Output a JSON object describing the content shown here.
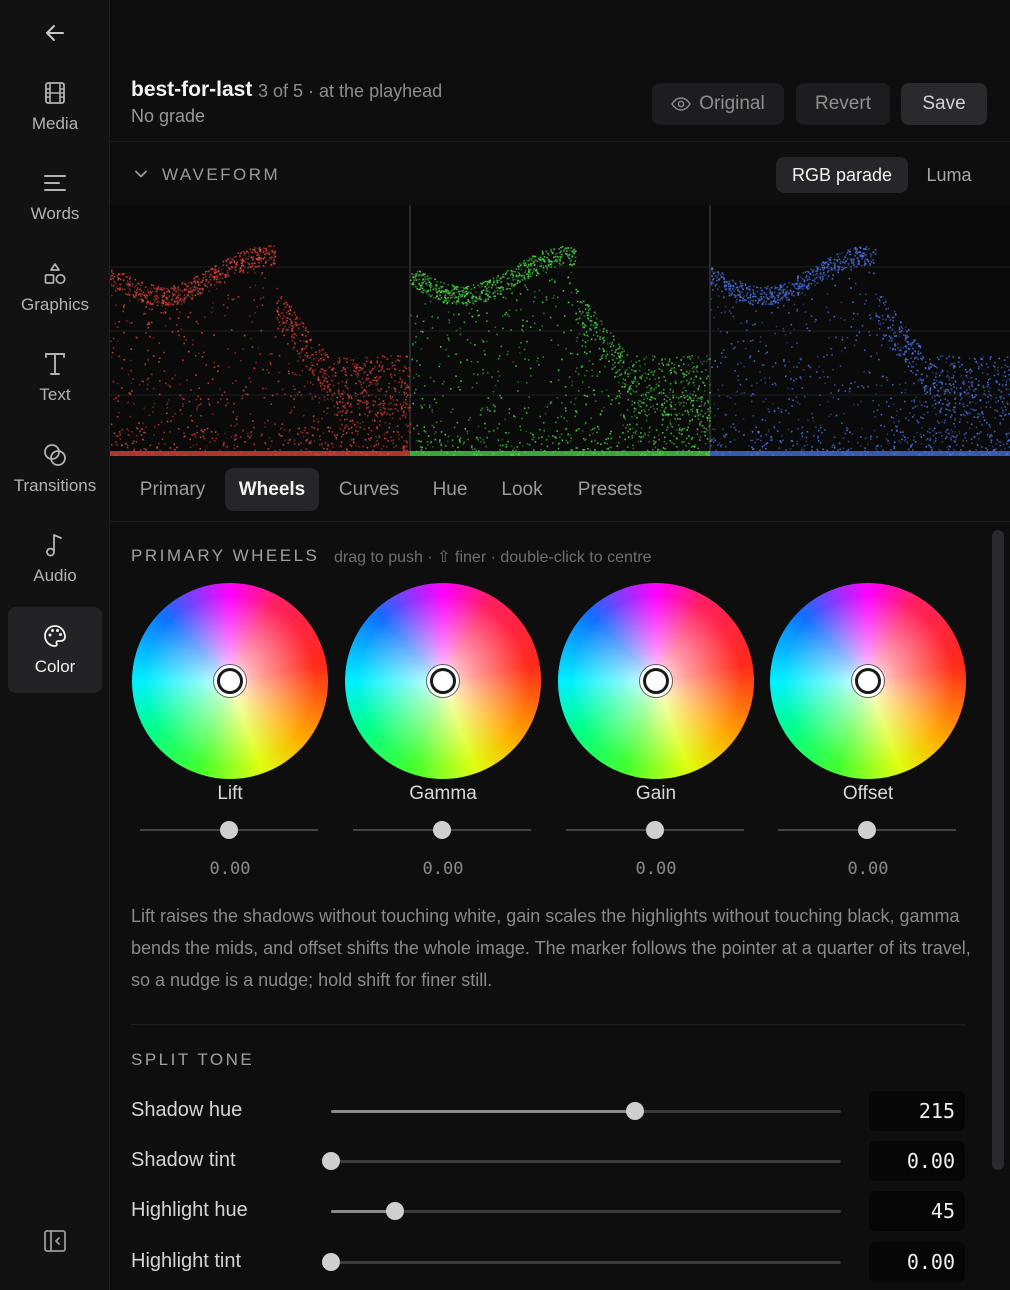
{
  "nav": {
    "items": [
      {
        "label": "Media",
        "icon": "film-icon",
        "active": false
      },
      {
        "label": "Words",
        "icon": "lines-icon",
        "active": false
      },
      {
        "label": "Graphics",
        "icon": "shapes-icon",
        "active": false
      },
      {
        "label": "Text",
        "icon": "text-icon",
        "active": false
      },
      {
        "label": "Transitions",
        "icon": "overlap-circles-icon",
        "active": false
      },
      {
        "label": "Audio",
        "icon": "music-note-icon",
        "active": false
      },
      {
        "label": "Color",
        "icon": "palette-icon",
        "active": true
      }
    ]
  },
  "header": {
    "clip_name": "best-for-last",
    "clip_meta": "3 of 5 · at the playhead",
    "grade_status": "No grade",
    "original_label": "Original",
    "revert_label": "Revert",
    "save_label": "Save"
  },
  "waveform": {
    "title": "WAVEFORM",
    "modes": [
      "RGB parade",
      "Luma"
    ],
    "active_mode": "RGB parade",
    "channel_colors": [
      "#e0453a",
      "#4cd94a",
      "#4a74e8"
    ]
  },
  "tabs": {
    "items": [
      "Primary",
      "Wheels",
      "Curves",
      "Hue",
      "Look",
      "Presets"
    ],
    "active": "Wheels"
  },
  "primary_wheels": {
    "title": "PRIMARY WHEELS",
    "hint": "drag to push · ⇧ finer · double-click to centre",
    "wheels": [
      {
        "label": "Lift",
        "value": "0.00",
        "level": 0.5
      },
      {
        "label": "Gamma",
        "value": "0.00",
        "level": 0.5
      },
      {
        "label": "Gain",
        "value": "0.00",
        "level": 0.5
      },
      {
        "label": "Offset",
        "value": "0.00",
        "level": 0.5
      }
    ],
    "description": "Lift raises the shadows without touching white, gain scales the highlights without touching black, gamma bends the mids, and offset shifts the whole image. The marker follows the pointer at a quarter of its travel, so a nudge is a nudge; hold shift for finer still."
  },
  "split_tone": {
    "title": "SPLIT TONE",
    "rows": [
      {
        "label": "Shadow hue",
        "value": "215",
        "fraction": 0.597
      },
      {
        "label": "Shadow tint",
        "value": "0.00",
        "fraction": 0.0
      },
      {
        "label": "Highlight hue",
        "value": "45",
        "fraction": 0.125
      },
      {
        "label": "Highlight tint",
        "value": "0.00",
        "fraction": 0.0
      }
    ]
  }
}
